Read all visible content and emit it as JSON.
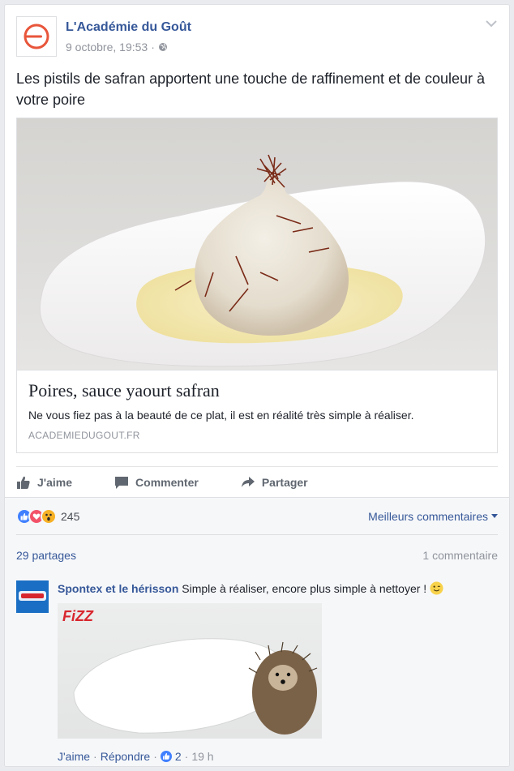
{
  "post": {
    "page_name": "L'Académie du Goût",
    "date": "9 octobre, 19:53",
    "separator": "·",
    "text": "Les pistils de safran apportent une touche de raffinement et de couleur à votre poire"
  },
  "link_preview": {
    "title": "Poires, sauce yaourt safran",
    "description": "Ne vous fiez pas à la beauté de ce plat, il est en réalité très simple à réaliser.",
    "domain": "ACADEMIEDUGOUT.FR"
  },
  "actions": {
    "like": "J'aime",
    "comment": "Commenter",
    "share": "Partager"
  },
  "reactions": {
    "count": "245",
    "sort_label": "Meilleurs commentaires"
  },
  "stats": {
    "shares": "29 partages",
    "comments": "1 commentaire"
  },
  "comment": {
    "author": "Spontex et le hérisson",
    "text": "Simple à réaliser, encore plus simple à nettoyer !",
    "image_logo": "FiZZ",
    "like": "J'aime",
    "sep": "·",
    "reply": "Répondre",
    "like_count": "2",
    "time": "19 h"
  },
  "colors": {
    "link_blue": "#365899",
    "fb_like": "#4080ff",
    "love": "#f25268",
    "wow": "#f7b125"
  }
}
